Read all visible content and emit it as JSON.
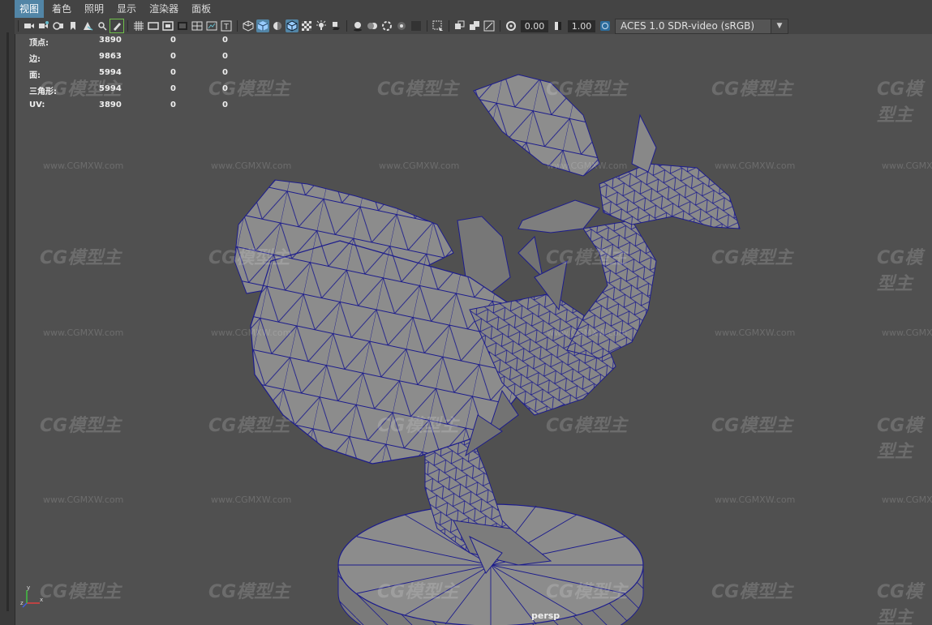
{
  "menu": {
    "items": [
      "视图",
      "着色",
      "照明",
      "显示",
      "渲染器",
      "面板"
    ],
    "active_index": 0
  },
  "toolbar": {
    "exposure_value": "0.00",
    "gamma_value": "1.00",
    "color_management": "ACES 1.0 SDR-video (sRGB)"
  },
  "hud": {
    "rows": [
      {
        "label": "顶点:",
        "v1": "3890",
        "v2": "0",
        "v3": "0"
      },
      {
        "label": "边:",
        "v1": "9863",
        "v2": "0",
        "v3": "0"
      },
      {
        "label": "面:",
        "v1": "5994",
        "v2": "0",
        "v3": "0"
      },
      {
        "label": "三角形:",
        "v1": "5994",
        "v2": "0",
        "v3": "0"
      },
      {
        "label": "UV:",
        "v1": "3890",
        "v2": "0",
        "v3": "0"
      }
    ]
  },
  "viewport": {
    "camera_label": "persp",
    "axis": {
      "x": "x",
      "y": "y",
      "z": "z"
    }
  },
  "watermark": {
    "logo_text": "CG模型主",
    "url": "www.CGMXW.com"
  },
  "colors": {
    "viewport_bg": "#505050",
    "wireframe": "#1c1c8c",
    "mesh_fill": "#8a8a8a",
    "menu_active": "#5285a6"
  }
}
